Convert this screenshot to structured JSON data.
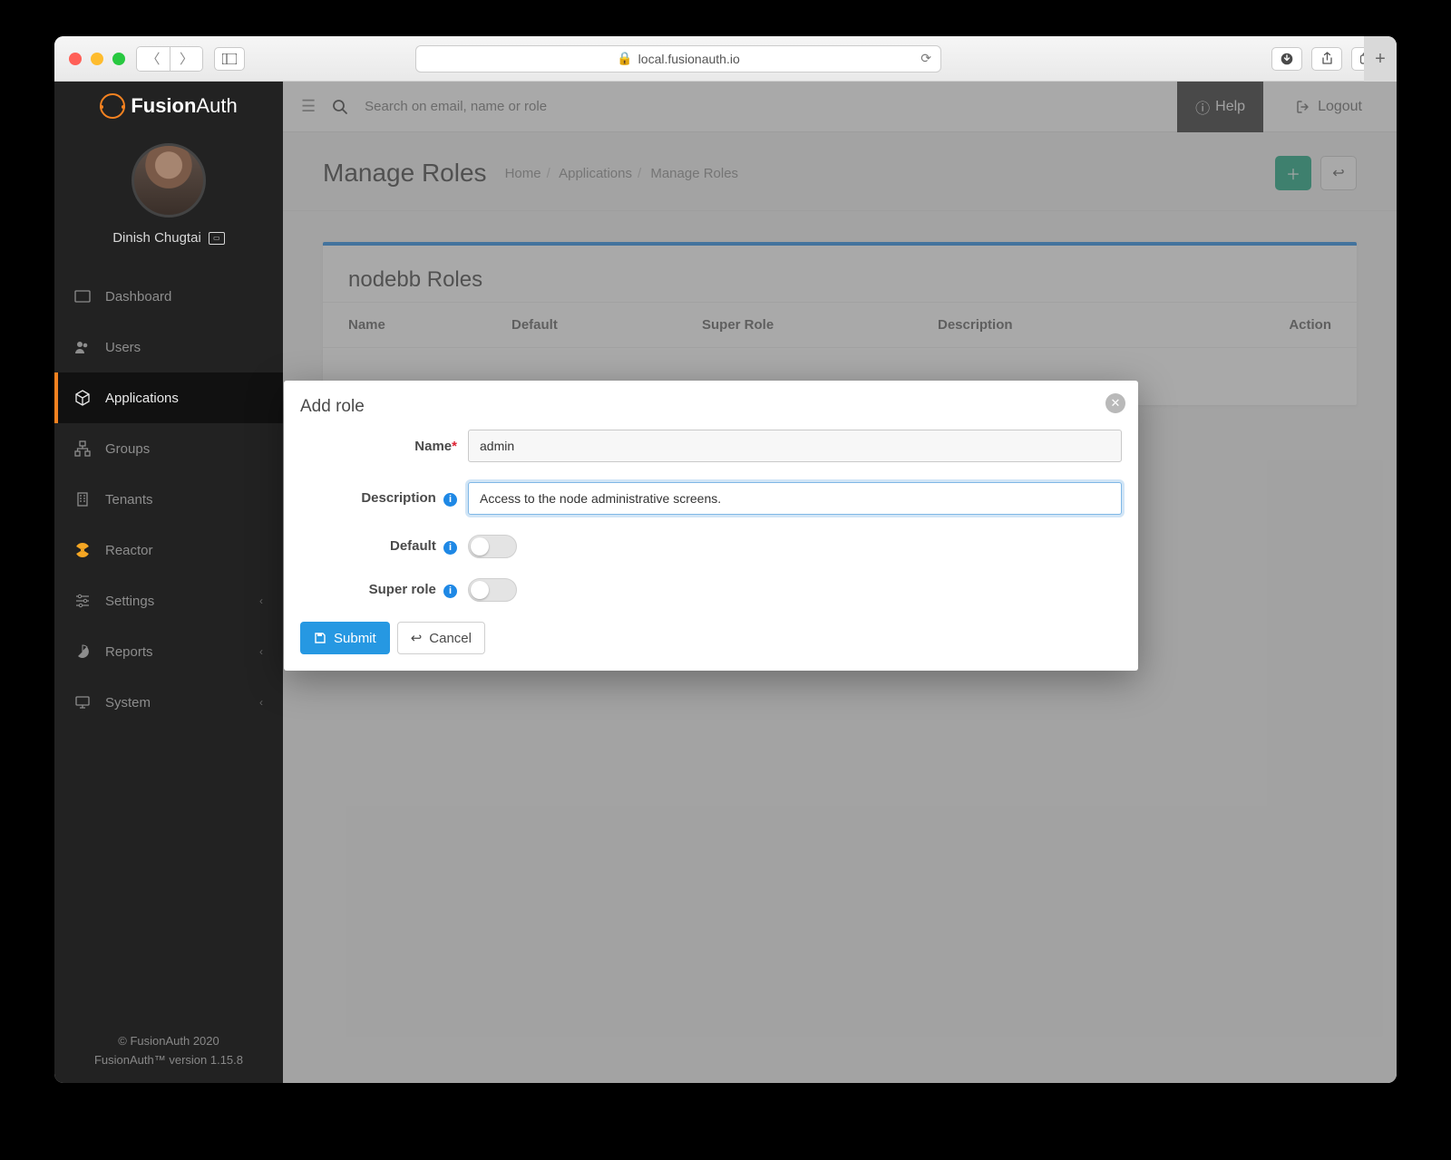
{
  "browser": {
    "url": "local.fusionauth.io"
  },
  "brand": {
    "name_a": "Fusion",
    "name_b": "Auth"
  },
  "user": {
    "name": "Dinish Chugtai"
  },
  "sidebar": {
    "items": [
      {
        "label": "Dashboard"
      },
      {
        "label": "Users"
      },
      {
        "label": "Applications"
      },
      {
        "label": "Groups"
      },
      {
        "label": "Tenants"
      },
      {
        "label": "Reactor"
      },
      {
        "label": "Settings"
      },
      {
        "label": "Reports"
      },
      {
        "label": "System"
      }
    ]
  },
  "footer": {
    "copyright": "© FusionAuth 2020",
    "version": "FusionAuth™ version 1.15.8"
  },
  "topbar": {
    "search_placeholder": "Search on email, name or role",
    "help": "Help",
    "logout": "Logout"
  },
  "page": {
    "title": "Manage Roles",
    "crumbs": {
      "home": "Home",
      "apps": "Applications",
      "current": "Manage Roles"
    }
  },
  "panel": {
    "title": "nodebb Roles",
    "columns": {
      "name": "Name",
      "default": "Default",
      "super": "Super Role",
      "desc": "Description",
      "action": "Action"
    }
  },
  "modal": {
    "title": "Add role",
    "labels": {
      "name": "Name",
      "description": "Description",
      "default": "Default",
      "super": "Super role"
    },
    "values": {
      "name": "admin",
      "description": "Access to the node administrative screens."
    },
    "buttons": {
      "submit": "Submit",
      "cancel": "Cancel"
    }
  }
}
